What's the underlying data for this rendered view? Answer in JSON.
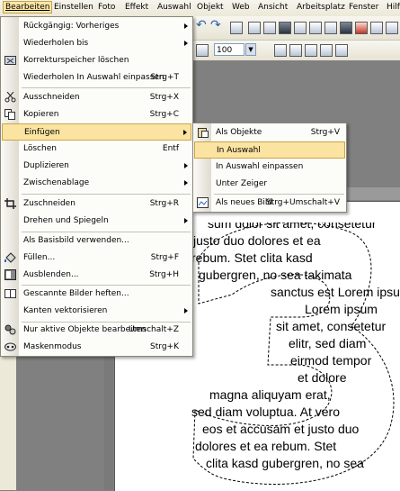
{
  "menubar": {
    "items": [
      {
        "label": "Bearbeiten",
        "mnemonic": "B"
      },
      {
        "label": "Einstellen",
        "mnemonic": "E"
      },
      {
        "label": "Foto",
        "mnemonic": "F"
      },
      {
        "label": "Effekt",
        "mnemonic": "k"
      },
      {
        "label": "Auswahl",
        "mnemonic": "w"
      },
      {
        "label": "Objekt",
        "mnemonic": "O"
      },
      {
        "label": "Web",
        "mnemonic": "W"
      },
      {
        "label": "Ansicht",
        "mnemonic": "A"
      },
      {
        "label": "Arbeitsplatz",
        "mnemonic": "p"
      },
      {
        "label": "Fenster",
        "mnemonic": "F"
      },
      {
        "label": "Hilfe",
        "mnemonic": "H"
      }
    ]
  },
  "toolbar": {
    "zoom_value": "100"
  },
  "edit_menu": {
    "items": [
      {
        "label": "Rückgängig: Vorheriges",
        "shortcut": "",
        "submenu": true
      },
      {
        "label": "Wiederholen bis",
        "shortcut": "",
        "submenu": true
      },
      {
        "label": "Korrekturspeicher löschen",
        "shortcut": ""
      },
      {
        "label": "Wiederholen In Auswahl einpassen",
        "shortcut": "Strg+T"
      },
      {
        "label": "Ausschneiden",
        "shortcut": "Strg+X"
      },
      {
        "label": "Kopieren",
        "shortcut": "Strg+C"
      },
      {
        "label": "Einfügen",
        "shortcut": "",
        "submenu": true
      },
      {
        "label": "Löschen",
        "shortcut": "Entf"
      },
      {
        "label": "Duplizieren",
        "shortcut": "",
        "submenu": true
      },
      {
        "label": "Zwischenablage",
        "shortcut": "",
        "submenu": true
      },
      {
        "label": "Zuschneiden",
        "shortcut": "Strg+R"
      },
      {
        "label": "Drehen und Spiegeln",
        "shortcut": "",
        "submenu": true
      },
      {
        "label": "Als Basisbild verwenden...",
        "shortcut": ""
      },
      {
        "label": "Füllen...",
        "shortcut": "Strg+F"
      },
      {
        "label": "Ausblenden...",
        "shortcut": "Strg+H"
      },
      {
        "label": "Gescannte Bilder heften...",
        "shortcut": ""
      },
      {
        "label": "Kanten vektorisieren",
        "shortcut": "",
        "submenu": true
      },
      {
        "label": "Nur aktive Objekte bearbeiten",
        "shortcut": "Umschalt+Z"
      },
      {
        "label": "Maskenmodus",
        "shortcut": "Strg+K"
      }
    ]
  },
  "paste_submenu": {
    "items": [
      {
        "label": "Als Objekte",
        "shortcut": "Strg+V"
      },
      {
        "label": "In Auswahl",
        "shortcut": ""
      },
      {
        "label": "In Auswahl einpassen",
        "shortcut": ""
      },
      {
        "label": "Unter Zeiger",
        "shortcut": ""
      },
      {
        "label": "Als neues Bild",
        "shortcut": "Strg+Umschalt+V"
      }
    ]
  },
  "document": {
    "lines": [
      "sum dolor sit amet, consetetur",
      "justo duo dolores et ea",
      "rebum. Stet clita kasd",
      "gubergren, no sea takimata",
      "sanctus est Lorem ipsum",
      "Lorem ipsum",
      "sit amet, consetetur",
      "elitr, sed diam",
      "eirmod tempor",
      "et dolore",
      "magna aliquyam erat,",
      "sed diam voluptua. At vero",
      "eos et accusam et justo duo",
      "dolores et ea rebum. Stet",
      "clita kasd gubergren, no sea"
    ]
  },
  "colors": {
    "menu_highlight": "#fbe3a1",
    "menu_highlight_border": "#c9a54a",
    "workspace": "#808080"
  }
}
